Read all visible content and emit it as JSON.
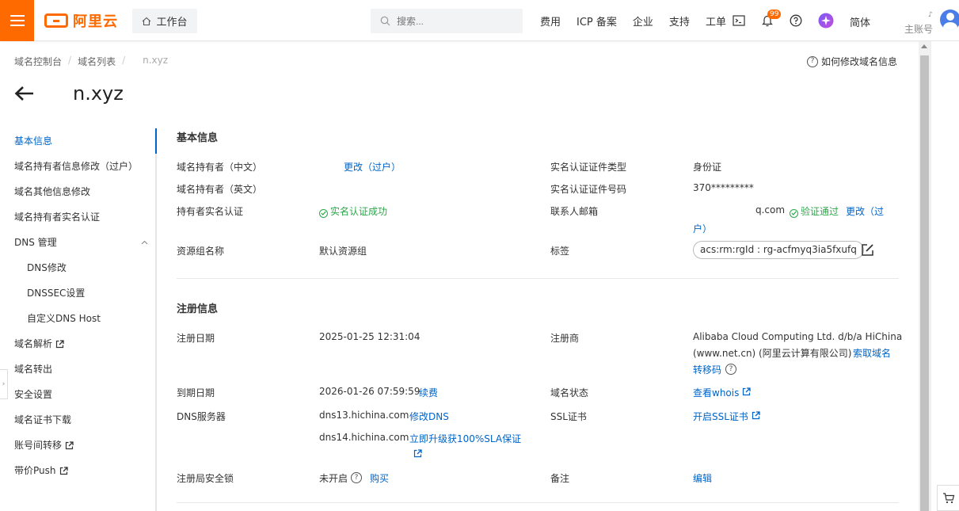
{
  "topbar": {
    "logo_text": "阿里云",
    "workbench_label": "工作台",
    "search_placeholder": "搜索...",
    "nav": [
      "费用",
      "ICP 备案",
      "企业",
      "支持",
      "工单"
    ],
    "notification_count": "99",
    "language": "简体",
    "account_label": "主账号",
    "account_dot": "♪",
    "accent_color": "#ff6a00"
  },
  "breadcrumb": {
    "items": [
      "域名控制台",
      "域名列表"
    ],
    "current": "n.xyz"
  },
  "help_link": "如何修改域名信息",
  "page_title": "n.xyz",
  "sidebar": {
    "items": [
      "基本信息",
      "域名持有者信息修改（过户）",
      "域名其他信息修改",
      "域名持有者实名认证",
      "DNS 管理",
      "DNS修改",
      "DNSSEC设置",
      "自定义DNS Host",
      "域名解析",
      "域名转出",
      "安全设置",
      "域名证书下载",
      "账号间转移",
      "带价Push"
    ],
    "active_color": "#0064c8"
  },
  "basic": {
    "title": "基本信息",
    "owner_cn_label": "域名持有者（中文）",
    "owner_cn_action": "更改（过户）",
    "owner_en_label": "域名持有者（英文）",
    "realname_label": "持有者实名认证",
    "realname_status": "实名认证成功",
    "resource_group_label": "资源组名称",
    "resource_group_value": "默认资源组",
    "cert_type_label": "实名认证证件类型",
    "cert_type_value": "身份证",
    "cert_no_label": "实名认证证件号码",
    "cert_no_value": "370*********",
    "email_label": "联系人邮箱",
    "email_value": "q.com",
    "email_status": "验证通过",
    "email_action_1": "更改（过",
    "email_action_2": "户）",
    "tag_label": "标签",
    "tag_value": "acs:rm:rgId : rg-acfmyq3ia5fxufq"
  },
  "registration": {
    "title": "注册信息",
    "reg_date_label": "注册日期",
    "reg_date_value": "2025-01-25 12:31:04",
    "registrar_label": "注册商",
    "registrar_line1": "Alibaba Cloud Computing Ltd. d/b/a HiChina",
    "registrar_line2": "(www.net.cn) (阿里云计算有限公司)",
    "registrar_action_1": "索取域名",
    "registrar_action_2": "转移码",
    "expire_label": "到期日期",
    "expire_value": "2026-01-26 07:59:59",
    "renew_action": "续费",
    "status_label": "域名状态",
    "whois_action": "查看whois",
    "dns_label": "DNS服务器",
    "dns1": "dns13.hichina.com",
    "dns_modify_action": "修改DNS",
    "dns2": "dns14.hichina.com",
    "dns_upgrade_action": "立即升级获100%SLA保证",
    "ssl_label": "SSL证书",
    "ssl_action": "开启SSL证书",
    "lock_label": "注册局安全锁",
    "lock_value": "未开启",
    "lock_action": "购买",
    "note_label": "备注",
    "note_action": "编辑"
  }
}
